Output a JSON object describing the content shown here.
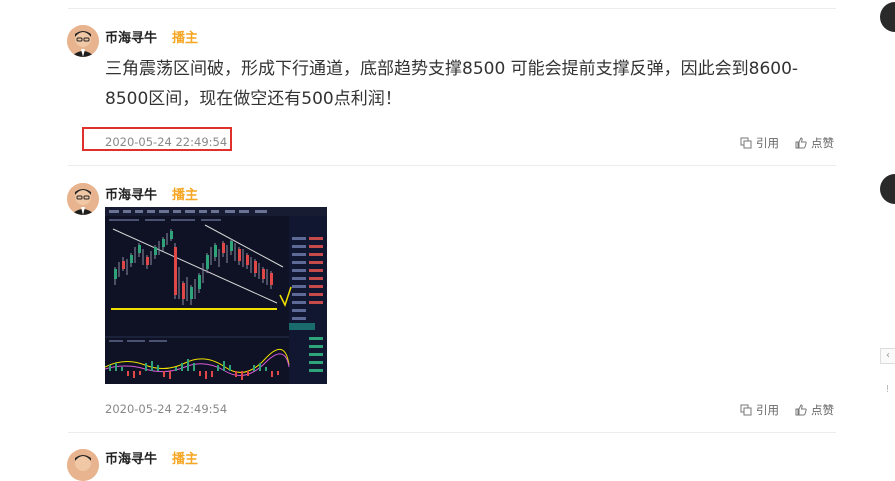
{
  "posts": [
    {
      "author": "币海寻牛",
      "role": "播主",
      "text_line1": "三角震荡区间破，形成下行通道，底部趋势支撑8500 可能会提前支撑反弹，因此会到8600-",
      "text_line2": "8500区间，现在做空还有500点利润！",
      "time": "2020-05-24 22:49:54",
      "quote_label": "引用",
      "like_label": "点赞"
    },
    {
      "author": "币海寻牛",
      "role": "播主",
      "time": "2020-05-24 22:49:54",
      "quote_label": "引用",
      "like_label": "点赞",
      "image": "candlestick-chart-screenshot"
    },
    {
      "author": "币海寻牛",
      "role": "播主"
    }
  ],
  "colors": {
    "role": "#f5a623",
    "highlight_border": "#e0302c",
    "chart_bg": "#0e1224",
    "chart_support_line": "#f0e000"
  },
  "icons": [
    "quote-icon",
    "thumbs-up-icon"
  ]
}
